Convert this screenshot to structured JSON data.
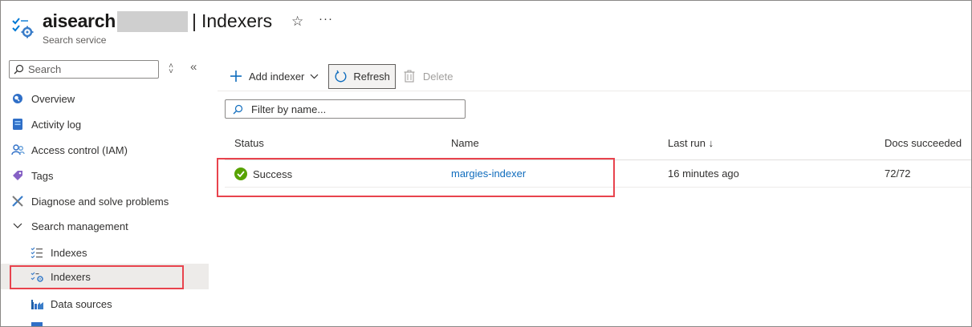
{
  "header": {
    "service_name": "aisearch",
    "separator": "|",
    "page_title": "Indexers",
    "subtitle": "Search service",
    "icons": {
      "service": "search-service-icon",
      "favorite": "star-icon",
      "more": "more-icon"
    }
  },
  "sidebar": {
    "search_placeholder": "Search",
    "items": [
      {
        "label": "Overview",
        "icon": "cloud-icon"
      },
      {
        "label": "Activity log",
        "icon": "activity-log-icon"
      },
      {
        "label": "Access control (IAM)",
        "icon": "people-icon"
      },
      {
        "label": "Tags",
        "icon": "tag-icon"
      },
      {
        "label": "Diagnose and solve problems",
        "icon": "wrench-icon"
      },
      {
        "label": "Search management",
        "icon": "chevron-down-icon"
      },
      {
        "label": "Indexes",
        "icon": "indexes-icon"
      },
      {
        "label": "Indexers",
        "icon": "indexers-icon",
        "selected": true
      },
      {
        "label": "Data sources",
        "icon": "data-sources-icon"
      }
    ]
  },
  "toolbar": {
    "add_label": "Add indexer",
    "refresh_label": "Refresh",
    "delete_label": "Delete"
  },
  "filter": {
    "placeholder": "Filter by name..."
  },
  "table": {
    "columns": [
      "Status",
      "Name",
      "Last run ↓",
      "Docs succeeded"
    ],
    "rows": [
      {
        "status": "Success",
        "name": "margies-indexer",
        "last_run": "16 minutes ago",
        "docs": "72/72"
      }
    ]
  },
  "colors": {
    "accent": "#0f6cbd",
    "highlight": "#e8434d",
    "success": "#57a300"
  }
}
